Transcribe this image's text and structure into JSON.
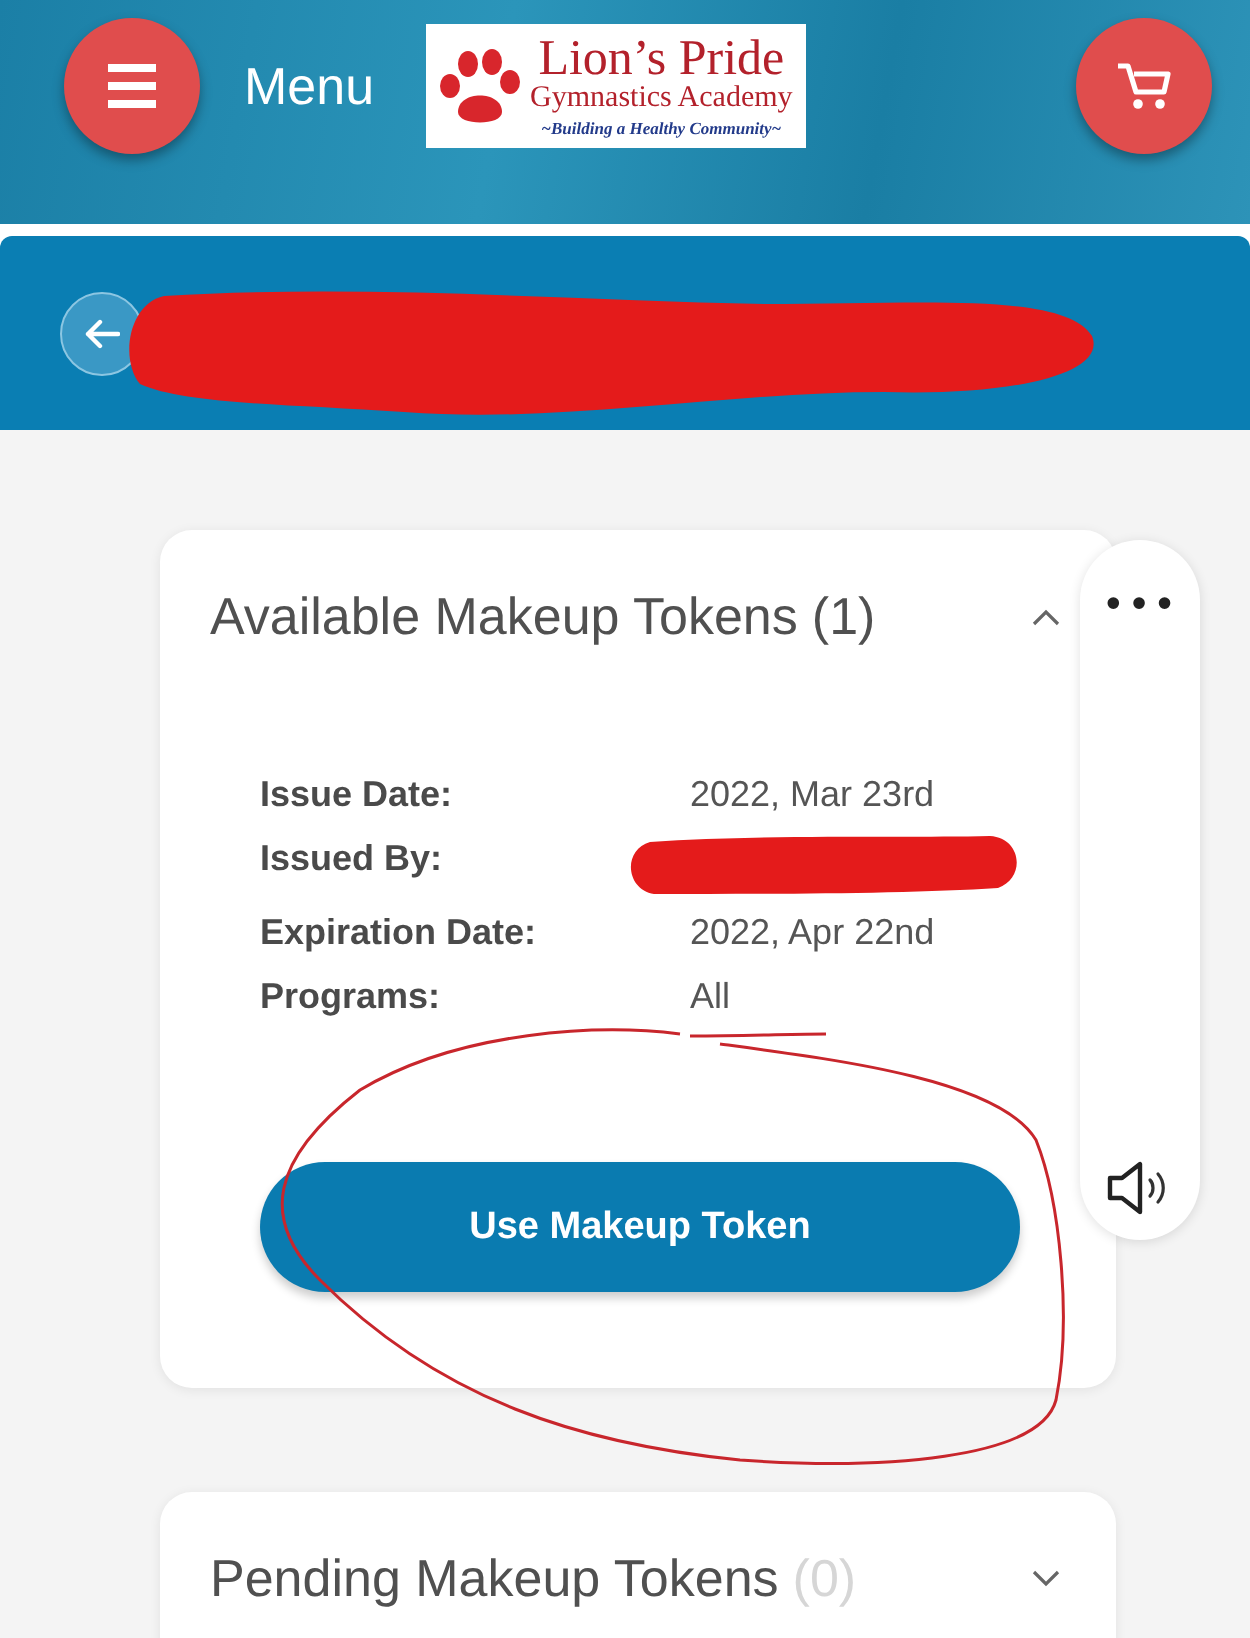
{
  "header": {
    "menu_label": "Menu",
    "logo": {
      "title": "Lion’s Pride",
      "subtitle": "Gymnastics Academy",
      "tagline": "~Building a Healthy Community~"
    }
  },
  "page_bar": {
    "title_redacted": true
  },
  "sections": [
    {
      "title": "Available Makeup Tokens",
      "count": "(1)",
      "count_dimmed": false,
      "expanded": true,
      "details": [
        {
          "label": "Issue Date:",
          "value": "2022, Mar 23rd",
          "redacted": false
        },
        {
          "label": "Issued By:",
          "redacted": true
        },
        {
          "label": "Expiration Date:",
          "value": "2022, Apr 22nd",
          "redacted": false
        },
        {
          "label": "Programs:",
          "value": "All",
          "redacted": false
        }
      ],
      "button": "Use Makeup Token"
    },
    {
      "title": "Pending Makeup Tokens",
      "count": "(0)",
      "count_dimmed": true,
      "expanded": false
    }
  ],
  "side_tools": {
    "more": "•••"
  },
  "annotations": {
    "underline": true,
    "circle": true
  }
}
